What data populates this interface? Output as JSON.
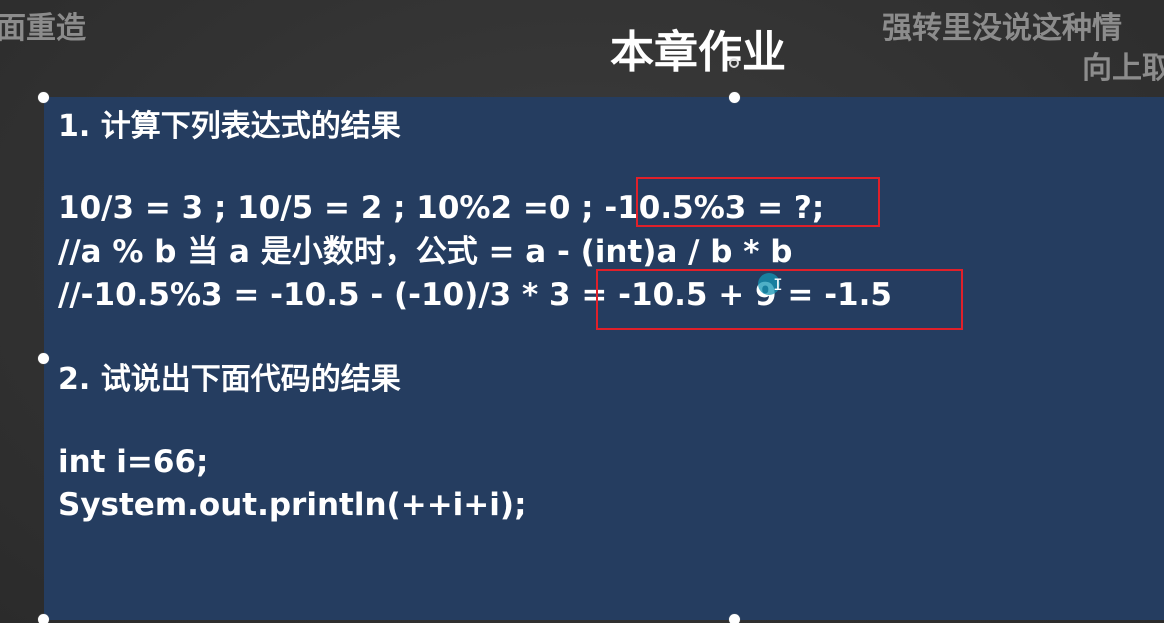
{
  "background": {
    "left_text": "面重造",
    "right_text_1": "强转里没说这种情",
    "right_text_2": "向上取"
  },
  "slide": {
    "title": "本章作业",
    "lines": [
      "1. 计算下列表达式的结果",
      "10/3 = 3  ; 10/5  = 2 ; 10%2 =0  ; -10.5%3 = ?;",
      "//a % b 当 a 是小数时，公式 = a - (int)a / b * b",
      "//-10.5%3 = -10.5 - (-10)/3 * 3 = -10.5 + 9 = -1.5",
      "2. 试说出下面代码的结果",
      "int i=66;",
      "System.out.println(++i+i);"
    ]
  },
  "cursor": {
    "glyph": "I"
  },
  "colors": {
    "panel": "#253d60",
    "highlight_border": "#e0202a",
    "text": "#ffffff"
  }
}
